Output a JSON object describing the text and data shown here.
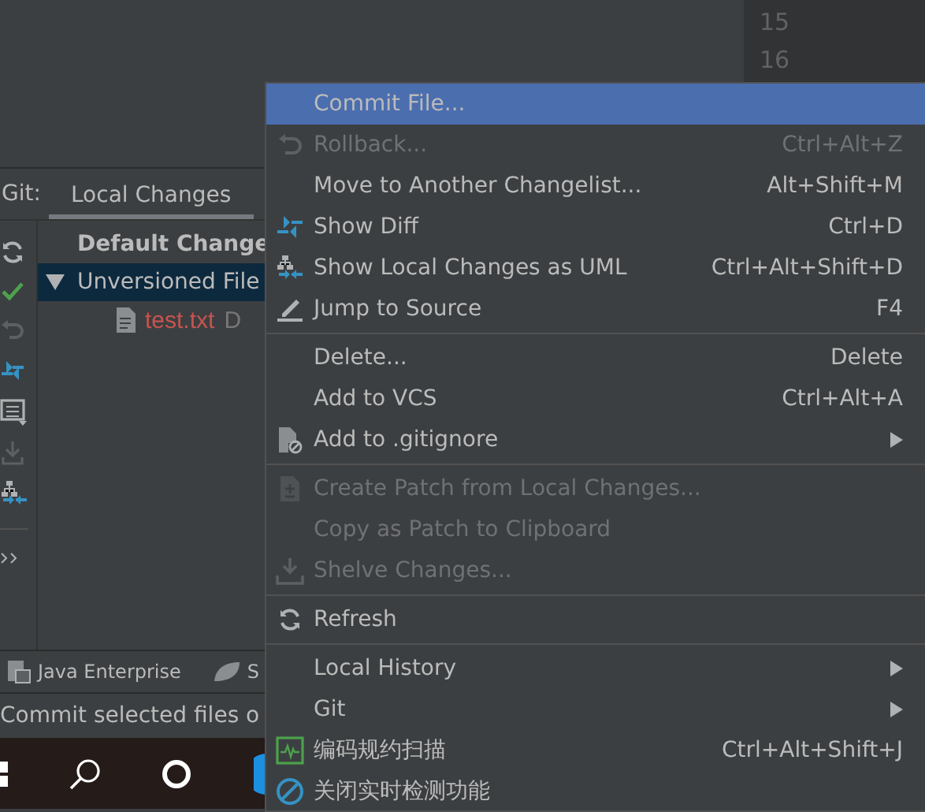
{
  "editor": {
    "line_numbers": [
      "15",
      "16"
    ]
  },
  "tool_window": {
    "title": "Git:",
    "tabs": [
      {
        "label": "Local Changes",
        "selected": true
      }
    ]
  },
  "tree": [
    {
      "label": "Default Change",
      "bold": true,
      "selected": false,
      "expanded": false
    },
    {
      "label": "Unversioned File",
      "bold": false,
      "selected": true,
      "expanded": true,
      "children": [
        {
          "label": "test.txt",
          "note": "D"
        }
      ]
    }
  ],
  "bottom_tabs": [
    {
      "label": "Java Enterprise"
    },
    {
      "label": "S"
    }
  ],
  "status_bar": "Commit selected files o",
  "context_menu": [
    {
      "kind": "item",
      "label": "Commit File...",
      "disabled": false,
      "selected": true,
      "submenu": false
    },
    {
      "kind": "item",
      "label": "Rollback...",
      "shortcut": "Ctrl+Alt+Z",
      "disabled": true,
      "selected": false,
      "submenu": false
    },
    {
      "kind": "item",
      "label": "Move to Another Changelist...",
      "shortcut": "Alt+Shift+M",
      "disabled": false,
      "selected": false,
      "submenu": false
    },
    {
      "kind": "item",
      "label": "Show Diff",
      "shortcut": "Ctrl+D",
      "disabled": false,
      "selected": false,
      "submenu": false
    },
    {
      "kind": "item",
      "label": "Show Local Changes as UML",
      "shortcut": "Ctrl+Alt+Shift+D",
      "disabled": false,
      "selected": false,
      "submenu": false
    },
    {
      "kind": "item",
      "label": "Jump to Source",
      "shortcut": "F4",
      "disabled": false,
      "selected": false,
      "submenu": false
    },
    {
      "kind": "separator"
    },
    {
      "kind": "item",
      "label": "Delete...",
      "shortcut": "Delete",
      "disabled": false,
      "selected": false,
      "submenu": false
    },
    {
      "kind": "item",
      "label": "Add to VCS",
      "shortcut": "Ctrl+Alt+A",
      "disabled": false,
      "selected": false,
      "submenu": false
    },
    {
      "kind": "item",
      "label": "Add to .gitignore",
      "disabled": false,
      "selected": false,
      "submenu": true
    },
    {
      "kind": "separator"
    },
    {
      "kind": "item",
      "label": "Create Patch from Local Changes...",
      "disabled": true,
      "selected": false,
      "submenu": false
    },
    {
      "kind": "item",
      "label": "Copy as Patch to Clipboard",
      "disabled": true,
      "selected": false,
      "submenu": false
    },
    {
      "kind": "item",
      "label": "Shelve Changes...",
      "disabled": true,
      "selected": false,
      "submenu": false
    },
    {
      "kind": "separator"
    },
    {
      "kind": "item",
      "label": "Refresh",
      "disabled": false,
      "selected": false,
      "submenu": false
    },
    {
      "kind": "separator"
    },
    {
      "kind": "item",
      "label": "Local History",
      "disabled": false,
      "selected": false,
      "submenu": true
    },
    {
      "kind": "item",
      "label": "Git",
      "disabled": false,
      "selected": false,
      "submenu": true
    },
    {
      "kind": "item",
      "label": "编码规约扫描",
      "shortcut": "Ctrl+Alt+Shift+J",
      "disabled": false,
      "selected": false,
      "submenu": false
    },
    {
      "kind": "item",
      "label": "关闭实时检测功能",
      "disabled": false,
      "selected": false,
      "submenu": false
    }
  ]
}
